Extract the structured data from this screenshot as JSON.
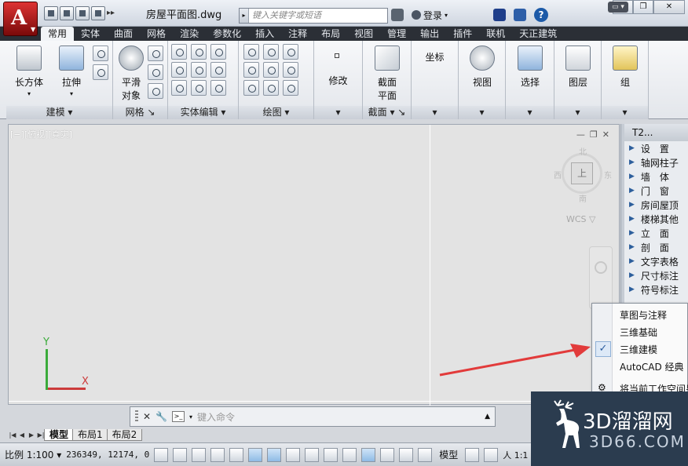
{
  "titlebar": {
    "doc_title": "房屋平面图.dwg",
    "search_placeholder": "键入关键字或短语",
    "login_label": "登录",
    "help_label": "?",
    "qat_more": "▸▸"
  },
  "ribbon": {
    "tabs": [
      "常用",
      "实体",
      "曲面",
      "网格",
      "渲染",
      "参数化",
      "插入",
      "注释",
      "布局",
      "视图",
      "管理",
      "输出",
      "插件",
      "联机",
      "天正建筑"
    ],
    "active_tab": "常用",
    "panels": {
      "modeling": {
        "title": "建模 ▾",
        "box_label": "长方体",
        "extrude_label": "拉伸"
      },
      "mesh": {
        "title": "网格 ↘",
        "smooth_label_1": "平滑",
        "smooth_label_2": "对象"
      },
      "solid_edit": {
        "title": "实体编辑 ▾"
      },
      "draw": {
        "title": "绘图 ▾"
      },
      "modify": {
        "label": "修改",
        "title": "▾"
      },
      "section": {
        "label_1": "截面",
        "label_2": "平面",
        "title": "截面 ▾ ↘"
      },
      "coordinates": {
        "label": "坐标",
        "title": "▾"
      },
      "view": {
        "label": "视图",
        "title": "▾"
      },
      "selection": {
        "label": "选择",
        "title": "▾"
      },
      "layers": {
        "label": "图层",
        "title": "▾"
      },
      "groups": {
        "label": "组",
        "title": "▾"
      }
    }
  },
  "viewport": {
    "label": "[−][俯视][真实]",
    "navcube_top": "上",
    "navcube_n": "北",
    "navcube_s": "南",
    "navcube_e": "东",
    "navcube_w": "西",
    "wcs_label": "WCS ▽",
    "ucs_x": "X",
    "ucs_y": "Y"
  },
  "command": {
    "placeholder": "键入命令"
  },
  "layout_tabs": [
    "模型",
    "布局1",
    "布局2"
  ],
  "statusbar": {
    "scale": "比例 1:100 ▾",
    "coords": "236349, 12174, 0",
    "model_label": "模型",
    "annot_scale": "人 1:1"
  },
  "palette": {
    "header": "T2...",
    "items": [
      "设　置",
      "轴网柱子",
      "墙　体",
      "门　窗",
      "房间屋顶",
      "楼梯其他",
      "立　面",
      "剖　面",
      "文字表格",
      "尺寸标注",
      "符号标注"
    ]
  },
  "workspace_menu": {
    "items": [
      "草图与注释",
      "三维基础",
      "三维建模",
      "AutoCAD 经典",
      "将当前工作空间另"
    ],
    "checked": "三维建模"
  },
  "watermark": {
    "line1": "3D溜溜网",
    "line2": "3D66.COM"
  },
  "colors": {
    "accent_red": "#e23b3b",
    "ucs_green": "#3bab3b",
    "ucs_red": "#cc3b3b"
  }
}
